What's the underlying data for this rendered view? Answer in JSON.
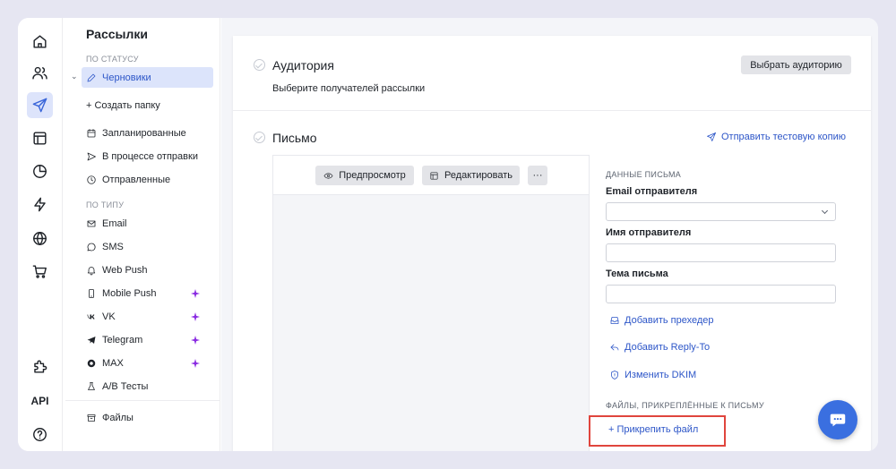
{
  "rail": {
    "items": [
      {
        "icon": "home-icon"
      },
      {
        "icon": "users-icon"
      },
      {
        "icon": "send-icon",
        "active": true
      },
      {
        "icon": "layout-icon"
      },
      {
        "icon": "pie-chart-icon"
      },
      {
        "icon": "lightning-icon"
      },
      {
        "icon": "globe-icon"
      },
      {
        "icon": "cart-icon"
      },
      {
        "icon": "puzzle-icon"
      },
      {
        "icon": "help-icon"
      }
    ],
    "api_label": "API"
  },
  "sidebar": {
    "title": "Рассылки",
    "status_section": "ПО СТАТУСУ",
    "drafts": "Черновики",
    "create_folder": "+ Создать папку",
    "scheduled": "Запланированные",
    "sending": "В процессе отправки",
    "sent": "Отправленные",
    "type_section": "ПО ТИПУ",
    "types": [
      {
        "label": "Email",
        "icon": "mail-icon"
      },
      {
        "label": "SMS",
        "icon": "chat-bubble-icon"
      },
      {
        "label": "Web Push",
        "icon": "bell-icon"
      },
      {
        "label": "Mobile Push",
        "icon": "phone-icon",
        "badge": true
      },
      {
        "label": "VK",
        "icon": "vk-icon",
        "badge": true
      },
      {
        "label": "Telegram",
        "icon": "telegram-icon",
        "badge": true
      },
      {
        "label": "MAX",
        "icon": "max-icon",
        "badge": true
      },
      {
        "label": "A/B Тесты",
        "icon": "flask-icon"
      }
    ],
    "files": "Файлы"
  },
  "audience": {
    "title": "Аудитория",
    "subtitle": "Выберите получателей рассылки",
    "button": "Выбрать аудиторию"
  },
  "letter": {
    "title": "Письмо",
    "send_test": "Отправить тестовую копию",
    "preview_button": "Предпросмотр",
    "edit_button": "Редактировать",
    "more_button": "···",
    "data_section": "ДАННЫЕ ПИСЬМА",
    "sender_email_label": "Email отправителя",
    "sender_email_value": "",
    "sender_name_label": "Имя отправителя",
    "sender_name_value": "",
    "subject_label": "Тема письма",
    "subject_value": "",
    "add_preheader": "Добавить прехедер",
    "add_reply_to": "Добавить Reply-To",
    "change_dkim": "Изменить DKIM",
    "files_section": "ФАЙЛЫ, ПРИКРЕПЛЁННЫЕ К ПИСЬМУ",
    "attach_file": "+ Прикрепить файл"
  },
  "colors": {
    "accent": "#2d56c8",
    "highlight_border": "#e0453d",
    "badge": "#8a2be2",
    "fab": "#3a6fe0"
  }
}
